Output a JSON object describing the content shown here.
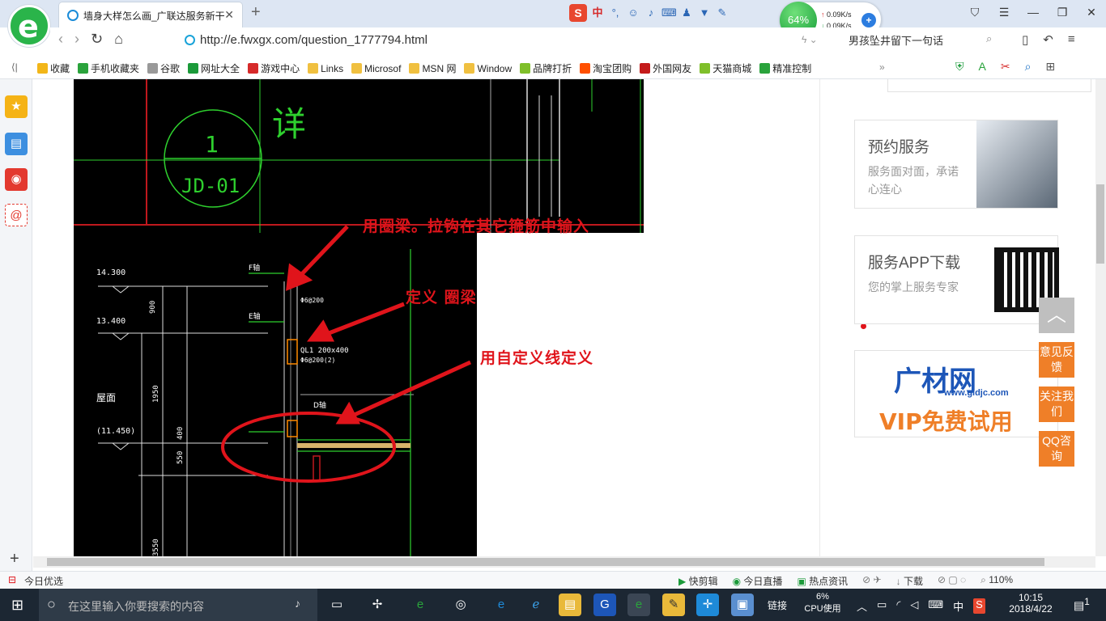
{
  "browser": {
    "tab_title": "墙身大样怎么画_广联达服务新干",
    "url": "http://e.fwxgx.com/question_1777794.html",
    "search_text": "男孩坠井留下一句话",
    "sogou_label": "中",
    "net": {
      "percent": "64%",
      "up": "0.09K/s",
      "down": "0.09K/s"
    }
  },
  "bookmarks": [
    {
      "label": "收藏",
      "icon": "star-icon",
      "color": "#f2b619"
    },
    {
      "label": "手机收藏夹",
      "icon": "phone-icon",
      "color": "#2aa33c"
    },
    {
      "label": "谷歌",
      "icon": "page-icon",
      "color": "#999999"
    },
    {
      "label": "网址大全",
      "icon": "globe-icon",
      "color": "#1b9a3a"
    },
    {
      "label": "游戏中心",
      "icon": "game-icon",
      "color": "#d62a2a"
    },
    {
      "label": "Links",
      "icon": "folder-icon",
      "color": "#f0c040"
    },
    {
      "label": "Microsof",
      "icon": "folder-icon",
      "color": "#f0c040"
    },
    {
      "label": "MSN 网",
      "icon": "folder-icon",
      "color": "#f0c040"
    },
    {
      "label": "Window",
      "icon": "folder-icon",
      "color": "#f0c040"
    },
    {
      "label": "品牌打折",
      "icon": "leaf-icon",
      "color": "#7fbf2a"
    },
    {
      "label": "淘宝团购",
      "icon": "taobao-icon",
      "color": "#ff5000"
    },
    {
      "label": "外国网友",
      "icon": "flag-icon",
      "color": "#c41b1b"
    },
    {
      "label": "天猫商城",
      "icon": "leaf-icon",
      "color": "#7fbf2a"
    },
    {
      "label": "精准控制",
      "icon": "chat-icon",
      "color": "#2aa33c"
    }
  ],
  "annotations": {
    "a1": "用圈梁。拉钩在其它箍筋中输入",
    "a2": "定义 圈梁",
    "a3": "用自定义线定义"
  },
  "cad_labels": {
    "circle_num": "1",
    "circle_code": "JD-01",
    "detail_char": "详",
    "elev1": "14.300",
    "elev2": "13.400",
    "elev3": "(11.450)",
    "roof": "屋面",
    "dim1": "900",
    "dim2": "1950",
    "dim3": "400",
    "dim4": "550",
    "dim5": "3550",
    "beam": "QL1 200x400",
    "rebar1": "Φ6@200",
    "rebar2": "Φ6@200(2)",
    "f": "F轴",
    "e": "E轴",
    "d": "D轴"
  },
  "cards": [
    {
      "title": "预约服务",
      "sub": "服务面对面，承诺心连心"
    },
    {
      "title": "服务APP下载",
      "sub": "您的掌上服务专家"
    }
  ],
  "ad": {
    "brand": "广材网",
    "site": "www.gldjc.com",
    "vip": "VIP免费试用"
  },
  "float_buttons": [
    "意见反馈",
    "关注我们",
    "QQ咨询"
  ],
  "status": {
    "left": "今日优选",
    "items": [
      "快剪辑",
      "今日直播",
      "热点资讯",
      "下载"
    ],
    "zoom": "110%"
  },
  "taskbar": {
    "search_placeholder": "在这里输入你要搜索的内容",
    "links": "链接",
    "cpu": "6%",
    "cpu_label": "CPU使用",
    "ime": "中",
    "time": "10:15",
    "date": "2018/4/22",
    "notif": "1"
  }
}
